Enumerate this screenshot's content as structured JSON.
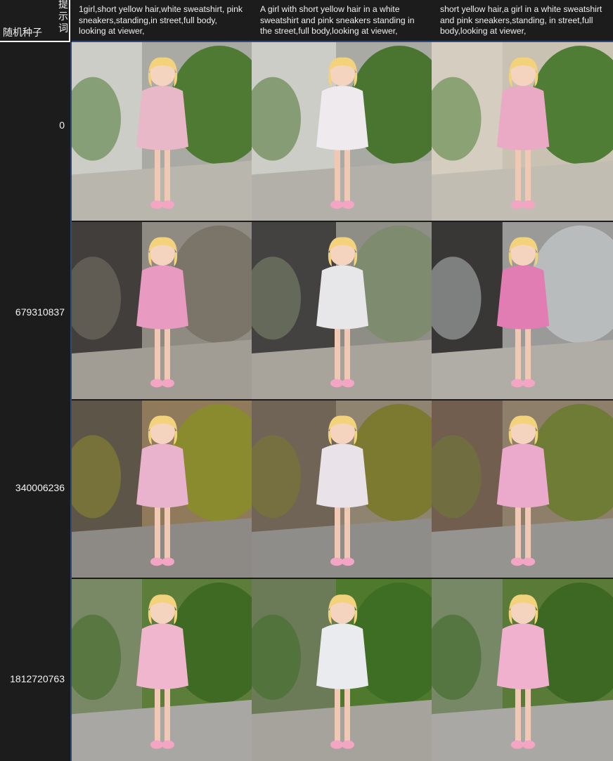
{
  "header": {
    "corner_prompt_label": "提示词",
    "corner_seed_label": "随机种子",
    "prompts": [
      "1girl,short yellow hair,white sweatshirt, pink sneakers,standing,in street,full body, looking at viewer,",
      "A girl with short yellow hair in a white sweatshirt and pink sneakers standing in the street,full body,looking at viewer,",
      "short yellow hair,a  girl in a white sweatshirt and pink sneakers,standing, in street,full body,looking at viewer,"
    ]
  },
  "rows": [
    {
      "seed": "0"
    },
    {
      "seed": "679310837"
    },
    {
      "seed": "340006236"
    },
    {
      "seed": "1812720763"
    }
  ],
  "images": [
    [
      {
        "desc": "girl-pink-hoodie-by-grey-wall-with-hedge",
        "bg": "#a9aaa3",
        "wall": "#cfd0cb",
        "foliage": "#4e7a34",
        "hoodie": "#e8b8c8",
        "ground": "#b9b6ae"
      },
      {
        "desc": "girl-white-hoodie-by-grey-wall-with-hedge",
        "bg": "#a9aaa3",
        "wall": "#cfd0cb",
        "foliage": "#4a7531",
        "hoodie": "#eeeaee",
        "ground": "#b3b0aa"
      },
      {
        "desc": "girl-pink-hoodie-on-sunny-alley",
        "bg": "#c9c1b2",
        "wall": "#d6cfc1",
        "foliage": "#4f7d35",
        "hoodie": "#eaa9c5",
        "ground": "#c2bdb3"
      }
    ],
    [
      {
        "desc": "girl-pink-hoodie-by-glass-storefront",
        "bg": "#8f8a82",
        "wall": "#3a3533",
        "foliage": "#7a7568",
        "hoodie": "#e89ac0",
        "ground": "#a29d94"
      },
      {
        "desc": "girl-white-hoodie-by-glass-storefront",
        "bg": "#8e8d86",
        "wall": "#3b3a38",
        "foliage": "#7f8b6e",
        "hoodie": "#e7e7ea",
        "ground": "#a8a49c"
      },
      {
        "desc": "girl-pink-hoodie-by-dark-storefront",
        "bg": "#9a9a98",
        "wall": "#2f2b2b",
        "foliage": "#b8bcbc",
        "hoodie": "#e27db4",
        "ground": "#b0aca6"
      }
    ],
    [
      {
        "desc": "girl-pink-hoodie-on-tree-lined-street",
        "bg": "#8f7a5c",
        "wall": "#595147",
        "foliage": "#8a8a2e",
        "hoodie": "#eab3cd",
        "ground": "#8d8a86"
      },
      {
        "desc": "girl-white-hoodie-on-tree-lined-street",
        "bg": "#8e8470",
        "wall": "#6b6152",
        "foliage": "#7c7a30",
        "hoodie": "#e9e2e8",
        "ground": "#8e8d8a"
      },
      {
        "desc": "girl-pink-hoodie-on-city-sidewalk",
        "bg": "#8e7f6a",
        "wall": "#6e5b4c",
        "foliage": "#6f7c35",
        "hoodie": "#eba9cb",
        "ground": "#969490"
      }
    ],
    [
      {
        "desc": "girl-pink-hoodie-on-leafy-path",
        "bg": "#5d7d3a",
        "wall": "#7c8a6a",
        "foliage": "#3f6a24",
        "hoodie": "#efb6ce",
        "ground": "#a9a7a3"
      },
      {
        "desc": "girl-white-hoodie-by-ivy-wall",
        "bg": "#4f7a2e",
        "wall": "#6f7b5c",
        "foliage": "#3e6d24",
        "hoodie": "#eaebee",
        "ground": "#a6a39d"
      },
      {
        "desc": "girl-pink-hoodie-on-leafy-path-2",
        "bg": "#5a7a38",
        "wall": "#7a8a6d",
        "foliage": "#3c6823",
        "hoodie": "#f0b1cf",
        "ground": "#aaa8a4"
      }
    ]
  ]
}
